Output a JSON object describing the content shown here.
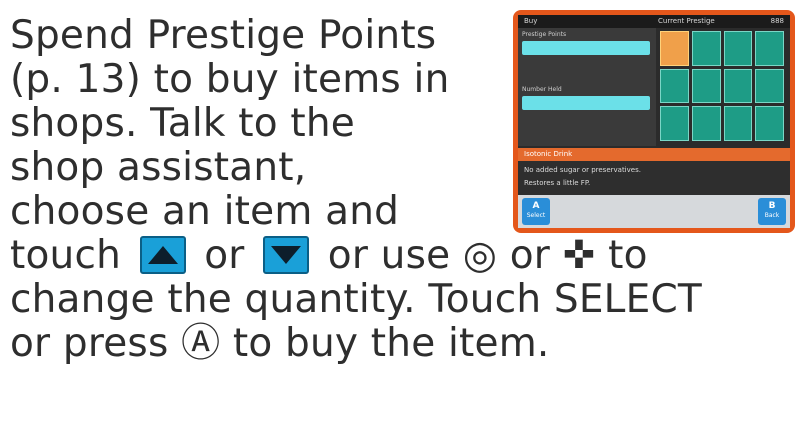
{
  "instructions": {
    "line1": "Spend Prestige Points",
    "line2": "(p. 13) to buy items in",
    "line3": "shops. Talk to the",
    "line4": "shop assistant,",
    "line5": "choose an item and",
    "line6a": "touch",
    "line6b": "or",
    "line6c": "or use",
    "circle_pad_glyph": "◎",
    "line6d": "or",
    "dpad_glyph": "✜",
    "line6e": "to",
    "line7": "change the quantity. Touch SELECT",
    "line8a": "or press",
    "a_button_glyph": "Ⓐ",
    "line8b": "to buy the item."
  },
  "icons": {
    "up": "up-arrow-button-icon",
    "down": "down-arrow-button-icon"
  },
  "screenshot": {
    "top_left": "Buy",
    "top_center": "Current Prestige",
    "top_right": "888",
    "pp_label": "Prestige Points",
    "pp_value": "",
    "num_label": "Number Held",
    "num_value": "",
    "item_name": "Isotonic Drink",
    "item_price": "",
    "desc_line1": "No added sugar or preservatives.",
    "desc_line2": "Restores a little FP.",
    "select_label": "Select",
    "back_label": "Back",
    "a_key": "A",
    "b_key": "B"
  },
  "colors": {
    "frame": "#e4571b",
    "accent_cyan": "#6be0e8",
    "button_blue": "#1aa0d8"
  }
}
